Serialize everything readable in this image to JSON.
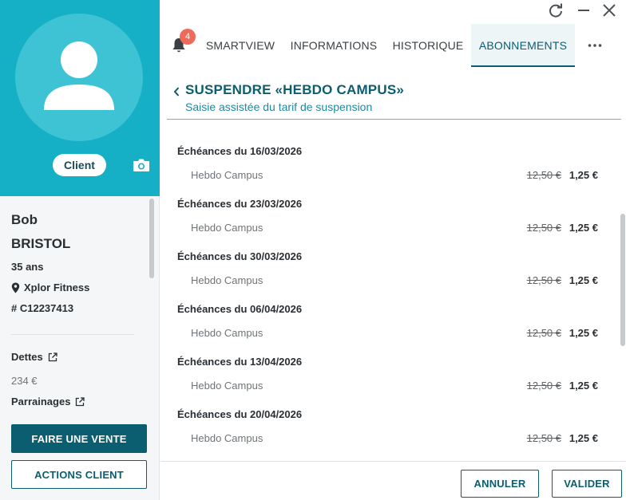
{
  "profile": {
    "badge_label": "Client",
    "first_name": "Bob",
    "last_name": "BRISTOL",
    "age": "35 ans",
    "location": "Xplor Fitness",
    "client_id": "# C12237413",
    "debts_label": "Dettes",
    "debts_value": "234 €",
    "referrals_label": "Parrainages"
  },
  "actions": {
    "sale_label": "FAIRE UNE VENTE",
    "client_actions_label": "ACTIONS CLIENT"
  },
  "nav": {
    "notifications_count": "4",
    "tabs": [
      {
        "label": "SMARTVIEW"
      },
      {
        "label": "INFORMATIONS"
      },
      {
        "label": "HISTORIQUE"
      },
      {
        "label": "ABONNEMENTS"
      }
    ],
    "active_tab": "ABONNEMENTS"
  },
  "header": {
    "title": "SUSPENDRE «HEBDO CAMPUS»",
    "subtitle": "Saisie assistée du tarif de suspension"
  },
  "schedule": [
    {
      "label": "Échéances du 16/03/2026",
      "item": "Hebdo Campus",
      "old_price": "12,50 €",
      "new_price": "1,25 €"
    },
    {
      "label": "Échéances du 23/03/2026",
      "item": "Hebdo Campus",
      "old_price": "12,50 €",
      "new_price": "1,25 €"
    },
    {
      "label": "Échéances du 30/03/2026",
      "item": "Hebdo Campus",
      "old_price": "12,50 €",
      "new_price": "1,25 €"
    },
    {
      "label": "Échéances du 06/04/2026",
      "item": "Hebdo Campus",
      "old_price": "12,50 €",
      "new_price": "1,25 €"
    },
    {
      "label": "Échéances du 13/04/2026",
      "item": "Hebdo Campus",
      "old_price": "12,50 €",
      "new_price": "1,25 €"
    },
    {
      "label": "Échéances du 20/04/2026",
      "item": "Hebdo Campus",
      "old_price": "12,50 €",
      "new_price": "1,25 €"
    }
  ],
  "footer": {
    "cancel_label": "ANNULER",
    "validate_label": "VALIDER"
  },
  "colors": {
    "brand_teal": "#16b0c6",
    "primary_dark": "#0b5d70",
    "badge_red": "#ef6a5b"
  },
  "icons": [
    "user-avatar-icon",
    "camera-icon",
    "location-pin-icon",
    "external-link-icon",
    "bell-icon",
    "refresh-icon",
    "minimize-icon",
    "close-icon",
    "more-icon",
    "chevron-left-icon"
  ]
}
